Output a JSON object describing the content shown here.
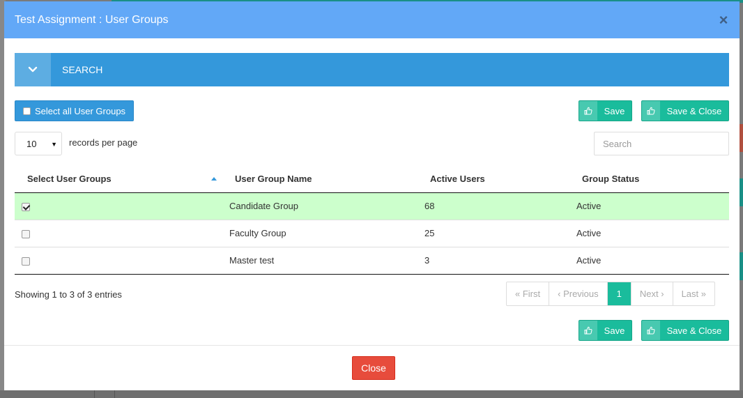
{
  "modal": {
    "title": "Test Assignment : User Groups",
    "close_x": "×",
    "close_button": "Close"
  },
  "search_panel": {
    "label": "SEARCH",
    "toggle_icon": "chevron-down-icon"
  },
  "toolbar": {
    "select_all_label": "Select all User Groups",
    "save_label": "Save",
    "save_close_label": "Save & Close",
    "save_icon": "thumbs-up-icon"
  },
  "length_menu": {
    "value": "10",
    "label": "records per page"
  },
  "search": {
    "placeholder": "Search"
  },
  "table": {
    "columns": [
      "Select User Groups",
      "User Group Name",
      "Active Users",
      "Group Status"
    ],
    "sorted_column": "Select User Groups",
    "sort_direction": "ascending",
    "rows": [
      {
        "checked": true,
        "name": "Candidate Group",
        "active_users": "68",
        "status": "Active"
      },
      {
        "checked": false,
        "name": "Faculty Group",
        "active_users": "25",
        "status": "Active"
      },
      {
        "checked": false,
        "name": "Master test",
        "active_users": "3",
        "status": "Active"
      }
    ]
  },
  "info": "Showing 1 to 3 of 3 entries",
  "pagination": {
    "first": "« First",
    "previous": "‹ Previous",
    "current": "1",
    "next": "Next ›",
    "last": "Last »"
  },
  "colors": {
    "header_bg": "#62a8f7",
    "search_bg": "#3498db",
    "primary_green": "#1abc9c",
    "close_red": "#e74c3c",
    "selected_row": "#ccffcc"
  }
}
